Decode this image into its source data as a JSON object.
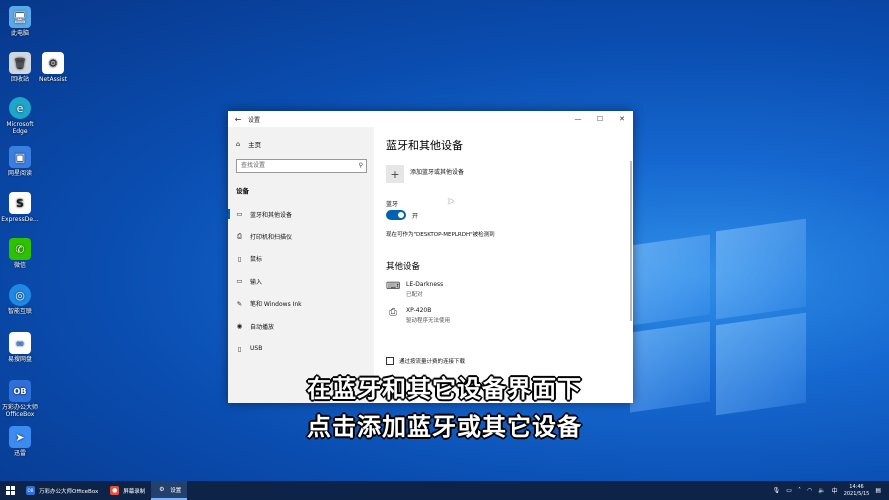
{
  "desktop": {
    "icons": [
      {
        "label": "此电脑",
        "glyph": "🖥"
      },
      {
        "label": "回收站",
        "glyph": "🗑"
      },
      {
        "label": "NetAssist",
        "glyph": "⚙"
      },
      {
        "label": "Microsoft Edge",
        "glyph": "e"
      },
      {
        "label": "网星阅读",
        "glyph": "▣"
      },
      {
        "label": "ExpressDe...",
        "glyph": "S"
      },
      {
        "label": "微信",
        "glyph": "✆"
      },
      {
        "label": "智能互联",
        "glyph": "◎"
      },
      {
        "label": "易搜网盘",
        "glyph": "∞"
      },
      {
        "label": "万彩办公大师OfficeBox",
        "glyph": "OB"
      },
      {
        "label": "迅雷",
        "glyph": "➤"
      }
    ]
  },
  "window": {
    "title": "设置",
    "back_glyph": "←",
    "controls": {
      "minimize": "—",
      "maximize": "☐",
      "close": "✕"
    }
  },
  "sidebar": {
    "home": "主页",
    "search_placeholder": "查找设置",
    "section": "设备",
    "items": [
      {
        "label": "蓝牙和其他设备",
        "icon": "▭"
      },
      {
        "label": "打印机和扫描仪",
        "icon": "⎙"
      },
      {
        "label": "鼠标",
        "icon": "▯"
      },
      {
        "label": "输入",
        "icon": "▭"
      },
      {
        "label": "笔和 Windows Ink",
        "icon": "✎"
      },
      {
        "label": "自动播放",
        "icon": "◉"
      },
      {
        "label": "USB",
        "icon": "▯"
      }
    ]
  },
  "content": {
    "title": "蓝牙和其他设备",
    "add_device": "添加蓝牙或其他设备",
    "bluetooth_label": "蓝牙",
    "bluetooth_state": "开",
    "discoverable": "现在可作为\"DESKTOP-MEPLRDH\"被检测到",
    "other_devices_heading": "其他设备",
    "devices": [
      {
        "name": "LE-Darkness",
        "status": "已配对",
        "icon": "⌨"
      },
      {
        "name": "XP-420B",
        "status": "驱动程序无法使用",
        "icon": "⎙"
      }
    ],
    "metered_label": "通过按流量计费的连接下载"
  },
  "subtitles": {
    "line1": "在蓝牙和其它设备界面下",
    "line2": "点击添加蓝牙或其它设备"
  },
  "taskbar": {
    "apps": [
      {
        "label": "万彩办公大师OfficeBox",
        "icon": "OB",
        "color": "#2f6fd8"
      },
      {
        "label": "屏幕录制",
        "icon": "●",
        "color": "#e8523b"
      },
      {
        "label": "设置",
        "icon": "⚙",
        "color": "#24406c"
      }
    ],
    "tray": {
      "ime": "中",
      "time": "14:46",
      "date": "2021/5/15"
    }
  }
}
